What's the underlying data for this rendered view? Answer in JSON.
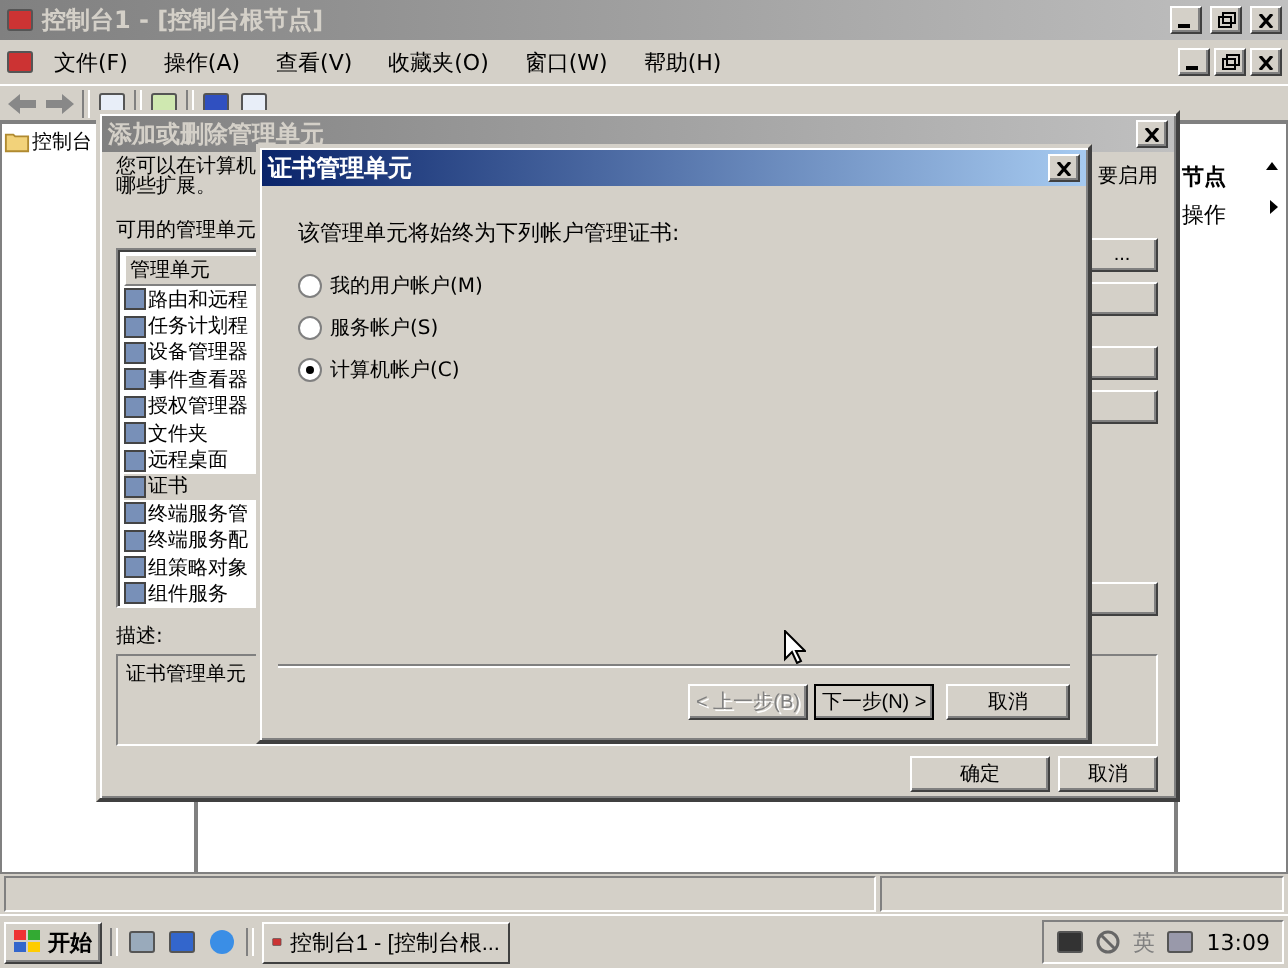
{
  "window": {
    "title": "控制台1 - [控制台根节点]"
  },
  "menu": [
    "文件(F)",
    "操作(A)",
    "查看(V)",
    "收藏夹(O)",
    "窗口(W)",
    "帮助(H)"
  ],
  "tree": [
    {
      "label": "控制台",
      "selected": false
    }
  ],
  "actions": {
    "header": "节点",
    "items": [
      "操作"
    ]
  },
  "add_dialog": {
    "title": "添加或删除管理单元",
    "intro": [
      "您可以在计算机",
      "哪些扩展。"
    ],
    "available_label": "可用的管理单元",
    "list_header": "管理单元",
    "snapins": [
      {
        "label": "路由和远程",
        "selected": false
      },
      {
        "label": "任务计划程",
        "selected": false
      },
      {
        "label": "设备管理器",
        "selected": false
      },
      {
        "label": "事件查看器",
        "selected": false
      },
      {
        "label": "授权管理器",
        "selected": false
      },
      {
        "label": "文件夹",
        "selected": false
      },
      {
        "label": "远程桌面",
        "selected": false
      },
      {
        "label": "证书",
        "selected": true
      },
      {
        "label": "终端服务管",
        "selected": false
      },
      {
        "label": "终端服务配",
        "selected": false
      },
      {
        "label": "组策略对象",
        "selected": false
      },
      {
        "label": "组件服务",
        "selected": false
      }
    ],
    "side_note": "要启用",
    "side_button": "...",
    "description_label": "描述:",
    "description": "证书管理单元",
    "buttons": [
      "确定",
      "取消"
    ]
  },
  "cert_dialog": {
    "title": "证书管理单元",
    "prompt": "该管理单元将始终为下列帐户管理证书:",
    "options": [
      {
        "label": "我的用户帐户(M)",
        "selected": false
      },
      {
        "label": "服务帐户(S)",
        "selected": false
      },
      {
        "label": "计算机帐户(C)",
        "selected": true
      }
    ],
    "buttons": [
      {
        "label": "< 上一步(B)",
        "disabled": true,
        "default": false
      },
      {
        "label": "下一步(N) >",
        "disabled": false,
        "default": true
      },
      {
        "label": "取消",
        "disabled": false,
        "default": false
      }
    ]
  },
  "taskbar": {
    "start": "开始",
    "tasks": [
      "控制台1 - [控制台根..."
    ],
    "tray_text": "英",
    "clock": "13:09"
  }
}
